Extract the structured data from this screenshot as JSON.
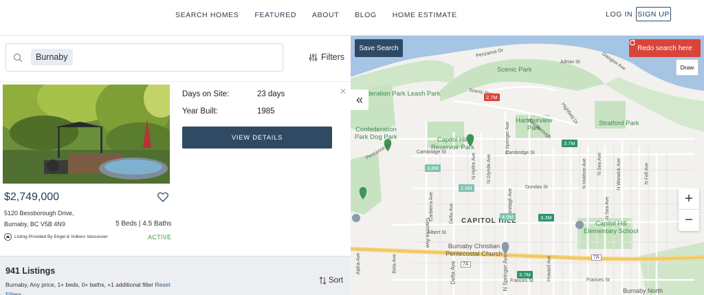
{
  "nav": {
    "links": [
      "SEARCH HOMES",
      "FEATURED",
      "ABOUT",
      "BLOG",
      "HOME ESTIMATE"
    ],
    "login": "LOG IN",
    "signup": "SIGN UP"
  },
  "search": {
    "chip": "Burnaby",
    "filters_label": "Filters"
  },
  "listing": {
    "price": "$2,749,000",
    "address_line1": "5120 Bessborough Drive,",
    "address_line2": "Burnaby, BC V5B 4N9",
    "beds_baths": "5 Beds | 4.5 Baths",
    "provided_by": "Listing Provided By Engel & Volkers Vancouver",
    "status": "ACTIVE",
    "days_on_site_label": "Days on Site:",
    "days_on_site_value": "23 days",
    "year_built_label": "Year Built:",
    "year_built_value": "1985",
    "view_details": "VIEW DETAILS"
  },
  "results": {
    "count": "941 Listings",
    "summary": "Burnaby, Any price, 1+ beds, 0+ baths, +1 additional filter",
    "reset": "Reset Filters",
    "sort": "Sort"
  },
  "map": {
    "save_search": "Save Search",
    "redo_search": "Redo search here",
    "draw": "Draw",
    "zoom_in": "+",
    "zoom_out": "−",
    "collapse": "«",
    "price_pins": [
      {
        "label": "2.7M",
        "color": "#d9453a"
      },
      {
        "label": "3.7M",
        "color": "#2f9170"
      },
      {
        "label": "3.8M",
        "color": "#7fc2b0"
      },
      {
        "label": "2.6M",
        "color": "#7fc2b0"
      },
      {
        "label": "4.5M",
        "color": "#7fc2b0"
      },
      {
        "label": "3.3M",
        "color": "#2f9170"
      },
      {
        "label": "3.7M",
        "color": "#2f9170"
      }
    ],
    "parks": [
      "Scenic Park",
      "Harbourview Park",
      "Stratford Park",
      "Capitol Hill Reservoir Park",
      "Confederation Park Dog Park",
      "Capitol Hill Elementary School",
      "Burnaby Christian Pentecostal Church"
    ],
    "labels": {
      "conf_park": "Confederation Park Leash Park",
      "capitol_hill": "CAPITOL HILL",
      "penzance": "Penzance Dr",
      "adrian": "Adrian St",
      "glasgow": "Glasgow Ave",
      "scenic_hwy": "Scenic Hwy",
      "cambridge": "Cambridge St",
      "dundas": "Dundas St",
      "albert": "Albert St",
      "frances": "Frances St",
      "hwy": "7A",
      "hyde": "N Hythe Ave",
      "glynde": "N Glynde Ave",
      "springer": "N Springer Ave",
      "gamma": "Gamma Ave",
      "delta": "Delta Ave",
      "alpha": "Alpha Ave",
      "beta": "Beta Ave",
      "canberra": "Canberra Ave",
      "ranelagh": "Ranelagh Ave",
      "holdom": "N Holdom Ave",
      "sea": "N Sea Ave",
      "warwick": "N Warwick Ave",
      "fell": "N Fell Ave",
      "howard": "Howard Ave",
      "bessborough": "Bessborough",
      "highfield": "Highfield Dr",
      "burnaby_north": "Burnaby North"
    }
  },
  "colors": {
    "primary": "#2d4a66",
    "danger": "#d9453a",
    "active": "#3a9a3a"
  }
}
